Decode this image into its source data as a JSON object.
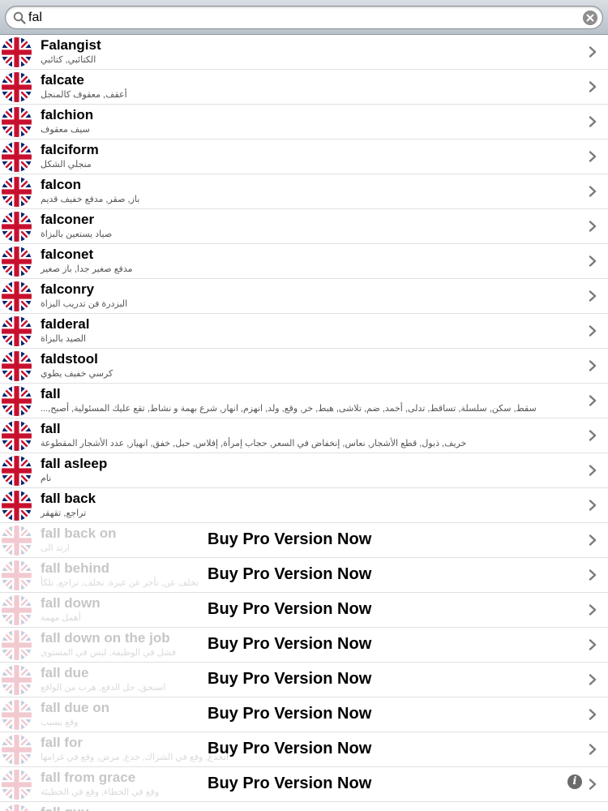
{
  "search": {
    "value": "fal"
  },
  "promo_label": "Buy Pro Version Now",
  "entries": [
    {
      "word": "Falangist",
      "translation": "الكتائبي, كتائبي",
      "pro": false
    },
    {
      "word": "falcate",
      "translation": "أعقف, معقوف كالمنجل",
      "pro": false
    },
    {
      "word": "falchion",
      "translation": "سيف معقوف",
      "pro": false
    },
    {
      "word": "falciform",
      "translation": "منجلي الشكل",
      "pro": false
    },
    {
      "word": "falcon",
      "translation": "باز, صقر, مدفع خفيف قديم",
      "pro": false
    },
    {
      "word": "falconer",
      "translation": "صياد يستعين بالبزاة",
      "pro": false
    },
    {
      "word": "falconet",
      "translation": "مدفع صغير جدا, باز صغير",
      "pro": false
    },
    {
      "word": "falconry",
      "translation": "البزدرة فن تدريب البزاة",
      "pro": false
    },
    {
      "word": "falderal",
      "translation": "الصيد بالبزاة",
      "pro": false
    },
    {
      "word": "faldstool",
      "translation": "كرسي خفيف يطوي",
      "pro": false
    },
    {
      "word": "fall",
      "translation": "سقط, سكن, سلسلة, تساقط, تدلى, أخمد, ضم, تلاشى, هبط, خر, وقع, ولد, انهزم, انهار, شرع بهمة و نشاط, تقع عليك المسئولية, أصبح,...",
      "pro": false
    },
    {
      "word": "fall",
      "translation": "خريف, ذبول, قطع الأشجار, نعاس, إنخفاض في السعر, حجاب إمرأة, إفلاس, حبل, خفق, انهيار, عدد الأشجار المقطوعة",
      "pro": false
    },
    {
      "word": "fall asleep",
      "translation": "نام",
      "pro": false
    },
    {
      "word": "fall back",
      "translation": "تراجع, تقهقر",
      "pro": false
    },
    {
      "word": "fall back on",
      "translation": "ارتد الى",
      "pro": true
    },
    {
      "word": "fall behind",
      "translation": "تخلف عن, تأخر عن غيره, تخلف, تراجع, تلكأ",
      "pro": true
    },
    {
      "word": "fall down",
      "translation": "أهمل مهمة",
      "pro": true
    },
    {
      "word": "fall down on the job",
      "translation": "فشل في الوظيفة, ليس في المستوى",
      "pro": true
    },
    {
      "word": "fall due",
      "translation": "استحق, حل الدفع, هرب من الواقع",
      "pro": true
    },
    {
      "word": "fall due on",
      "translation": "وقع بسبب",
      "pro": true
    },
    {
      "word": "fall for",
      "translation": "انخدع, وقع في الشراك, خدع, مرض, وقع في غرامها",
      "pro": true
    },
    {
      "word": "fall from grace",
      "translation": "وقع في الخطاء, وقع في الخطيئة",
      "pro": true,
      "info": true
    },
    {
      "word": "fall guy",
      "translation": "",
      "pro": true
    }
  ]
}
